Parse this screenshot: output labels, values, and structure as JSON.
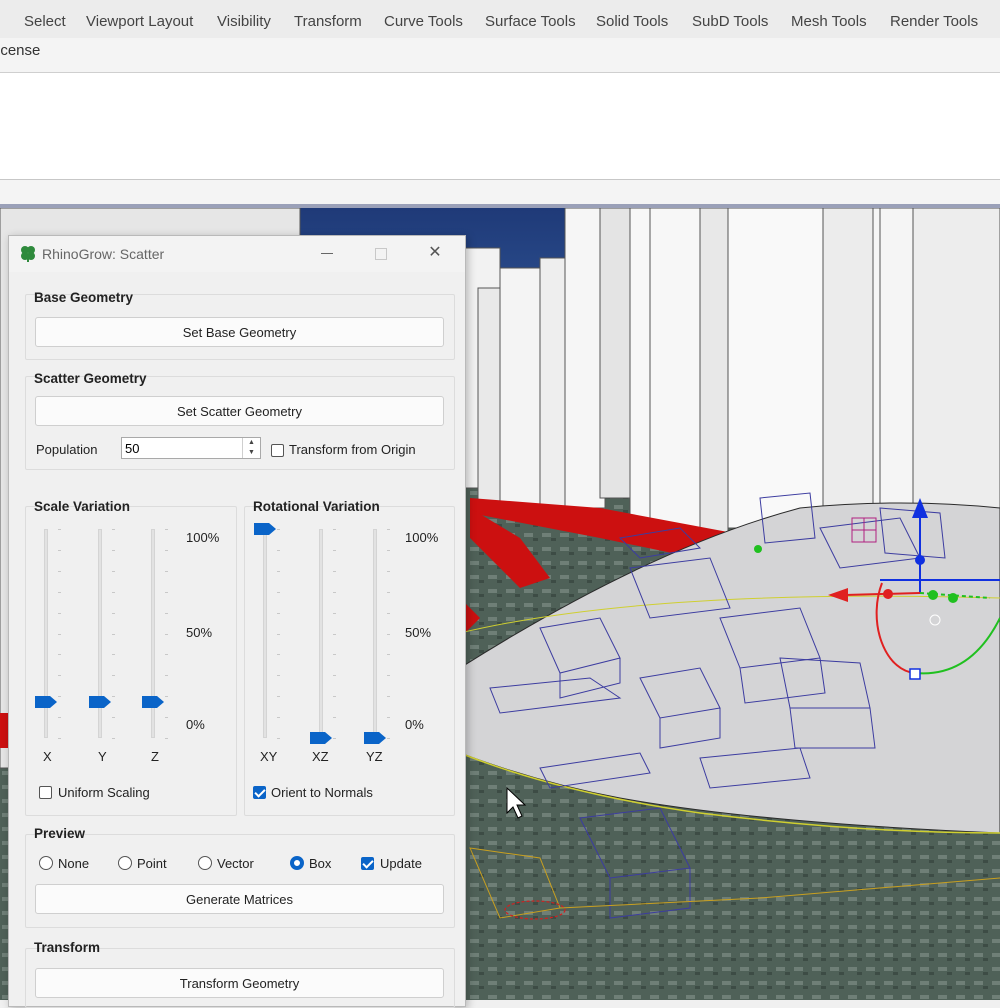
{
  "ribbon_tabs": [
    "Select",
    "Viewport Layout",
    "Visibility",
    "Transform",
    "Curve Tools",
    "Surface Tools",
    "Solid Tools",
    "SubD Tools",
    "Mesh Tools",
    "Render Tools"
  ],
  "license_label": "icense",
  "dialog": {
    "title": "RhinoGrow: Scatter",
    "base_geometry": {
      "title": "Base Geometry",
      "button": "Set Base Geometry"
    },
    "scatter_geometry": {
      "title": "Scatter Geometry",
      "button": "Set Scatter Geometry",
      "population_label": "Population",
      "population_value": "50",
      "transform_origin_label": "Transform from Origin",
      "transform_origin_checked": false
    },
    "scale_variation": {
      "title": "Scale Variation",
      "axes": [
        "X",
        "Y",
        "Z"
      ],
      "values_fraction": [
        0.17,
        0.17,
        0.17
      ],
      "uniform_label": "Uniform Scaling",
      "uniform_checked": false
    },
    "rotational_variation": {
      "title": "Rotational Variation",
      "axes": [
        "XY",
        "XZ",
        "YZ"
      ],
      "values_fraction": [
        1.0,
        0.0,
        0.0
      ],
      "orient_label": "Orient to Normals",
      "orient_checked": true
    },
    "scale_ticks": {
      "top": "100%",
      "mid": "50%",
      "bottom": "0%"
    },
    "preview": {
      "title": "Preview",
      "options": [
        "None",
        "Point",
        "Vector",
        "Box"
      ],
      "selected": "Box",
      "update_label": "Update",
      "update_checked": true,
      "button": "Generate Matrices"
    },
    "transform": {
      "title": "Transform",
      "button": "Transform Geometry"
    }
  },
  "icons": {
    "app": "clover-icon",
    "close": "close-icon",
    "maximize": "maximize-icon",
    "minimize": "minimize-icon"
  },
  "colors": {
    "accent": "#0a64c8",
    "gumball_x": "#e02020",
    "gumball_y": "#20c020",
    "gumball_z": "#1030e0",
    "scatter_boxes": "#3c3ca0"
  }
}
